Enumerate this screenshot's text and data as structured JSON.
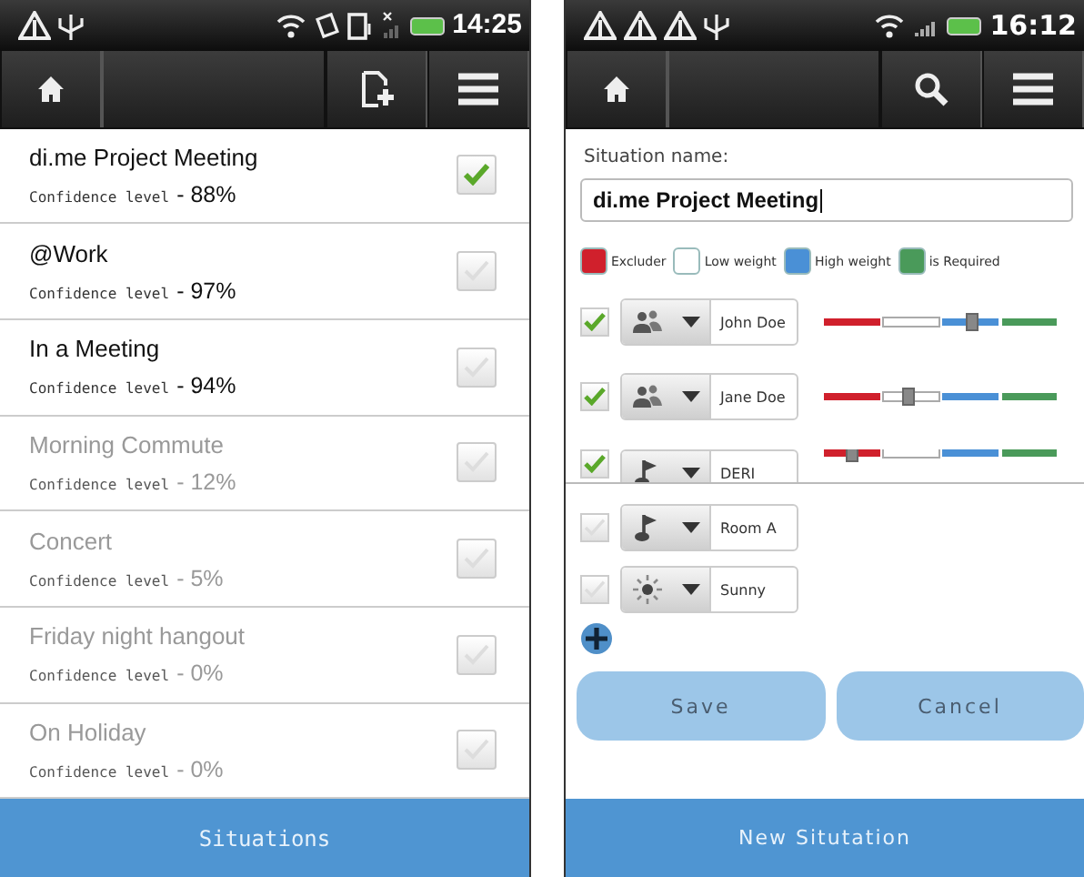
{
  "left_screen": {
    "status_bar": {
      "time": "14:25"
    },
    "situations": [
      {
        "name": "di.me Project Meeting",
        "confidence_label": "Confidence level",
        "confidence": "- 88%",
        "active": true,
        "checked": true
      },
      {
        "name": "@Work",
        "confidence_label": "Confidence level",
        "confidence": "- 97%",
        "active": true,
        "checked": false
      },
      {
        "name": "In a Meeting",
        "confidence_label": "Confidence level",
        "confidence": "- 94%",
        "active": true,
        "checked": false
      },
      {
        "name": "Morning Commute",
        "confidence_label": "Confidence level",
        "confidence": "- 12%",
        "active": false,
        "checked": false
      },
      {
        "name": "Concert",
        "confidence_label": "Confidence level",
        "confidence": "- 5%",
        "active": false,
        "checked": false
      },
      {
        "name": "Friday night hangout",
        "confidence_label": "Confidence level",
        "confidence": "- 0%",
        "active": false,
        "checked": false
      },
      {
        "name": "On Holiday",
        "confidence_label": "Confidence level",
        "confidence": "- 0%",
        "active": false,
        "checked": false
      }
    ],
    "bottom_bar": "Situations"
  },
  "right_screen": {
    "status_bar": {
      "time": "16:12"
    },
    "name_label": "Situation name:",
    "name_value": "di.me Project Meeting",
    "legend": [
      {
        "label": "Excluder",
        "color": "#d0202c"
      },
      {
        "label": "Low weight",
        "color": "#ffffff"
      },
      {
        "label": "High weight",
        "color": "#4a90d6"
      },
      {
        "label": "is Required",
        "color": "#4a9a5a"
      }
    ],
    "conditions": [
      {
        "kind": "person",
        "value": "John Doe",
        "checked": true,
        "level": 0.63
      },
      {
        "kind": "person",
        "value": "Jane Doe",
        "checked": true,
        "level": 0.36
      },
      {
        "kind": "place",
        "value": "DERI",
        "checked": true,
        "level": 0.12
      },
      {
        "kind": "place",
        "value": "Room A",
        "checked": false
      },
      {
        "kind": "weather",
        "value": "Sunny",
        "checked": false
      }
    ],
    "buttons": [
      "Save",
      "Cancel"
    ],
    "bottom_bar": "New Situtation"
  }
}
